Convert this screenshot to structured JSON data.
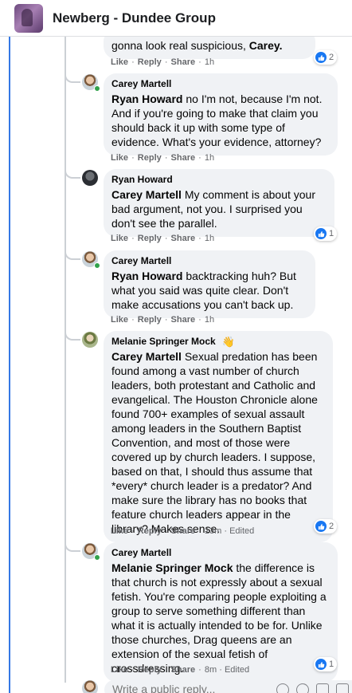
{
  "header": {
    "title": "Newberg - Dundee Group"
  },
  "actions": {
    "like": "Like",
    "reply": "Reply",
    "share": "Share"
  },
  "comments": [
    {
      "text": "gonna look real suspicious, ",
      "mention_end": "Carey.",
      "meta": "1h",
      "reactions": "2"
    },
    {
      "author": "Carey Martell",
      "mention": "Ryan Howard",
      "text": " no I'm not, because I'm not. And if you're going to make that claim you should back it up with some type of evidence. What's your evidence, attorney?",
      "meta": "1h"
    },
    {
      "author": "Ryan Howard",
      "mention": "Carey Martell",
      "text": " My comment is about your bad argument, not you. I surprised you don't see the parallel.",
      "meta": "1h",
      "reactions": "1"
    },
    {
      "author": "Carey Martell",
      "mention": "Ryan Howard",
      "text": " backtracking huh? But what you said was quite clear. Don't make accusations you can't back up.",
      "meta": "1h"
    },
    {
      "author": "Melanie Springer Mock",
      "author_badge": "wave-icon",
      "mention": "Carey Martell",
      "text": " Sexual predation has been found among a vast number of church leaders, both protestant and Catholic and evangelical. The Houston Chronicle alone found 700+ examples of sexual assault among leaders in the Southern Baptist Convention, and most of those were covered up by church leaders. I suppose, based on that, I should thus assume that *every* church leader is a predator? And make sure the library has no books that feature church leaders appear in the library? Makes sense.",
      "meta": "13m · Edited",
      "reactions": "2"
    },
    {
      "author": "Carey Martell",
      "mention": "Melanie Springer Mock",
      "text": " the difference is that church is not expressly about a sexual fetish. You're comparing people exploiting a group to serve something different than what it is actually intended to be for. Unlike those churches, Drag queens are an extension of the sexual fetish of crossdressing.",
      "meta": "8m · Edited",
      "reactions": "1"
    }
  ],
  "reply_box": {
    "placeholder": "Write a public reply..."
  },
  "colors": {
    "like_blue": "#1877f2",
    "bubble": "#f0f2f5",
    "online": "#31a24c",
    "thread_accent": "#3578e5"
  }
}
